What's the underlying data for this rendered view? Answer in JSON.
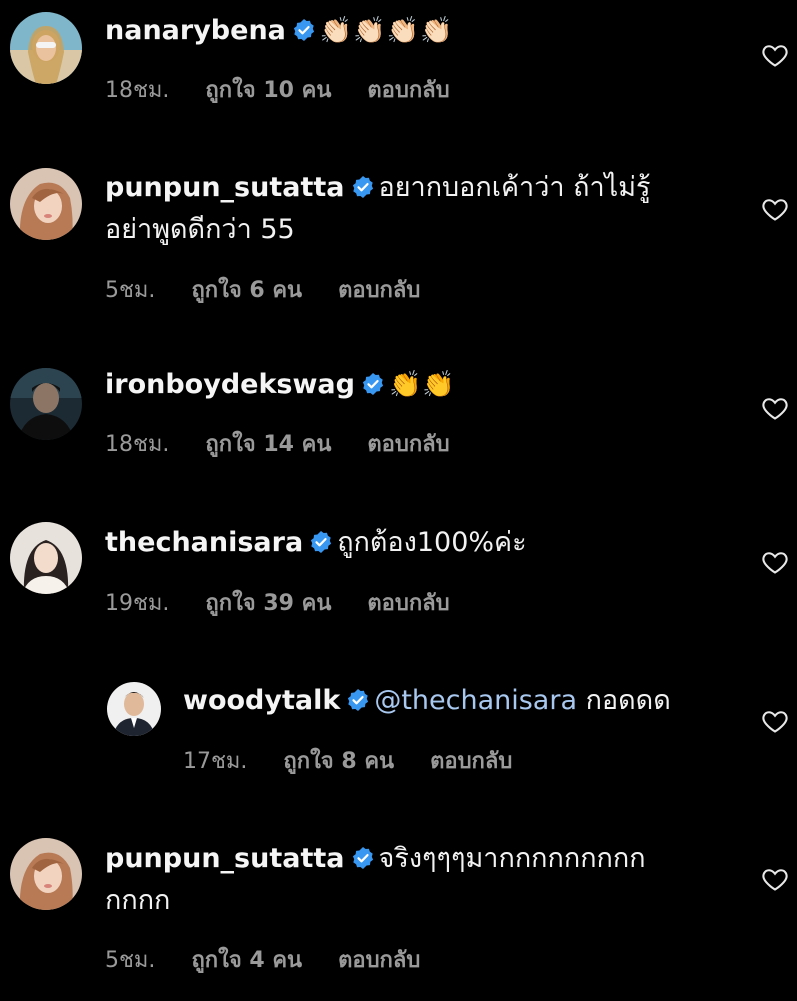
{
  "colors": {
    "background": "#000000",
    "verified_badge": "#3897f0",
    "meta_text": "#9a9a9a",
    "mention": "#a8c8f0"
  },
  "comments": [
    {
      "username": "nanarybena",
      "text": "",
      "emoji": "👏🏻👏🏻👏🏻👏🏻",
      "text_line2": "",
      "time": "18ชม.",
      "likes": "ถูกใจ 10 คน",
      "reply": "ตอบกลับ",
      "avatar_icon": "avatar-beach-woman-icon"
    },
    {
      "username": "punpun_sutatta",
      "text": "อยากบอกเค้าว่า ถ้าไม่รู้",
      "emoji": "",
      "text_line2": "อย่าพูดดีกว่า 55",
      "time": "5ชม.",
      "likes": "ถูกใจ 6 คน",
      "reply": "ตอบกลับ",
      "avatar_icon": "avatar-woman-portrait-icon"
    },
    {
      "username": "ironboydekswag",
      "text": "",
      "emoji": "👏👏",
      "text_line2": "",
      "time": "18ชม.",
      "likes": "ถูกใจ 14 คน",
      "reply": "ตอบกลับ",
      "avatar_icon": "avatar-man-dark-icon"
    },
    {
      "username": "thechanisara",
      "text": "ถูกต้อง100%ค่ะ",
      "emoji": "",
      "text_line2": "",
      "time": "19ชม.",
      "likes": "ถูกใจ 39 คน",
      "reply": "ตอบกลับ",
      "avatar_icon": "avatar-woman-light-icon"
    },
    {
      "username": "woodytalk",
      "mention": "@thechanisara",
      "text": " กอดดด",
      "emoji": "",
      "text_line2": "",
      "time": "17ชม.",
      "likes": "ถูกใจ 8 คน",
      "reply": "ตอบกลับ",
      "avatar_icon": "avatar-man-suit-icon"
    },
    {
      "username": "punpun_sutatta",
      "text": "จริงๆๆๆมากกกกกกกกก",
      "emoji": "",
      "text_line2": "กกกก",
      "time": "5ชม.",
      "likes": "ถูกใจ 4 คน",
      "reply": "ตอบกลับ",
      "avatar_icon": "avatar-woman-portrait-icon"
    }
  ]
}
